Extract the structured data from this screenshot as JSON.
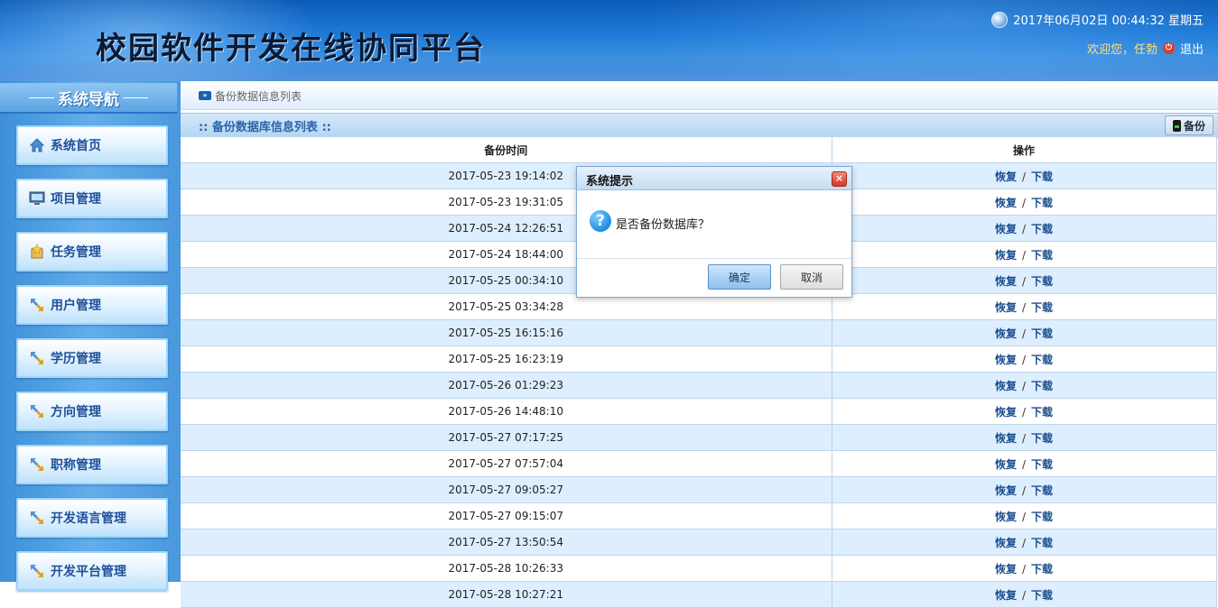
{
  "header": {
    "app_title": "校园软件开发在线协同平台",
    "datetime": "2017年06月02日 00:44:32 星期五",
    "welcome": "欢迎您，任勃",
    "logout": "退出"
  },
  "sidebar": {
    "title": "系统导航",
    "items": [
      {
        "label": "系统首页",
        "icon": "home-icon"
      },
      {
        "label": "项目管理",
        "icon": "monitor-icon"
      },
      {
        "label": "任务管理",
        "icon": "task-icon"
      },
      {
        "label": "用户管理",
        "icon": "arrows-icon"
      },
      {
        "label": "学历管理",
        "icon": "arrows-icon"
      },
      {
        "label": "方向管理",
        "icon": "arrows-icon"
      },
      {
        "label": "职称管理",
        "icon": "arrows-icon"
      },
      {
        "label": "开发语言管理",
        "icon": "arrows-icon"
      },
      {
        "label": "开发平台管理",
        "icon": "arrows-icon"
      }
    ]
  },
  "breadcrumb": "备份数据信息列表",
  "panel": {
    "title": ":: 备份数据库信息列表 ::",
    "backup_button": "备份"
  },
  "table": {
    "columns": [
      "备份时间",
      "操作"
    ],
    "restore_label": "恢复",
    "separator": "/",
    "download_label": "下载",
    "rows": [
      "2017-05-23 19:14:02",
      "2017-05-23 19:31:05",
      "2017-05-24 12:26:51",
      "2017-05-24 18:44:00",
      "2017-05-25 00:34:10",
      "2017-05-25 03:34:28",
      "2017-05-25 16:15:16",
      "2017-05-25 16:23:19",
      "2017-05-26 01:29:23",
      "2017-05-26 14:48:10",
      "2017-05-27 07:17:25",
      "2017-05-27 07:57:04",
      "2017-05-27 09:05:27",
      "2017-05-27 09:15:07",
      "2017-05-27 13:50:54",
      "2017-05-28 10:26:33",
      "2017-05-28 10:27:21"
    ]
  },
  "dialog": {
    "title": "系统提示",
    "message": "是否备份数据库？",
    "ok": "确定",
    "cancel": "取消"
  }
}
